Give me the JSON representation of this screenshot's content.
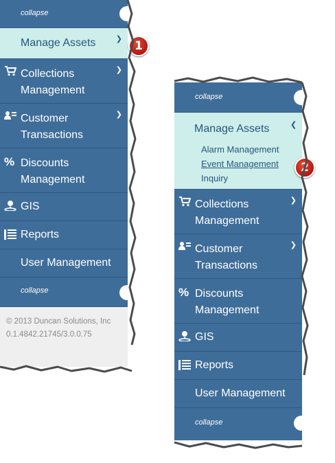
{
  "left_panel": {
    "collapse_top": "collapse",
    "collapse_bottom": "collapse",
    "items": [
      {
        "label": "Manage Assets",
        "icon": "chevron-down-icon"
      },
      {
        "label": "Collections Management",
        "icon": "cart-icon"
      },
      {
        "label": "Customer Transactions",
        "icon": "user-card-icon"
      },
      {
        "label": "Discounts Management",
        "icon": "percent-icon"
      },
      {
        "label": "GIS",
        "icon": "map-pin-icon"
      },
      {
        "label": "Reports",
        "icon": "list-icon"
      },
      {
        "label": "User Management",
        "icon": ""
      }
    ],
    "footer_copyright": "© 2013 Duncan Solutions, Inc",
    "footer_version": "0.1.4842.21745/3.0.0.75",
    "badge": "1"
  },
  "right_panel": {
    "collapse_top": "collapse",
    "collapse_bottom": "collapse",
    "manage_assets_label": "Manage Assets",
    "submenu": [
      "Alarm Management",
      "Event Management",
      "Inquiry"
    ],
    "items": [
      {
        "label": "Collections Management"
      },
      {
        "label": "Customer Transactions"
      },
      {
        "label": "Discounts Management"
      },
      {
        "label": "GIS"
      },
      {
        "label": "Reports"
      },
      {
        "label": "User Management"
      }
    ],
    "badge": "2"
  },
  "colors": {
    "menu_bg": "#3f6d99",
    "active_bg": "#cdeeea",
    "active_text": "#27577f",
    "badge": "#c8221a"
  }
}
